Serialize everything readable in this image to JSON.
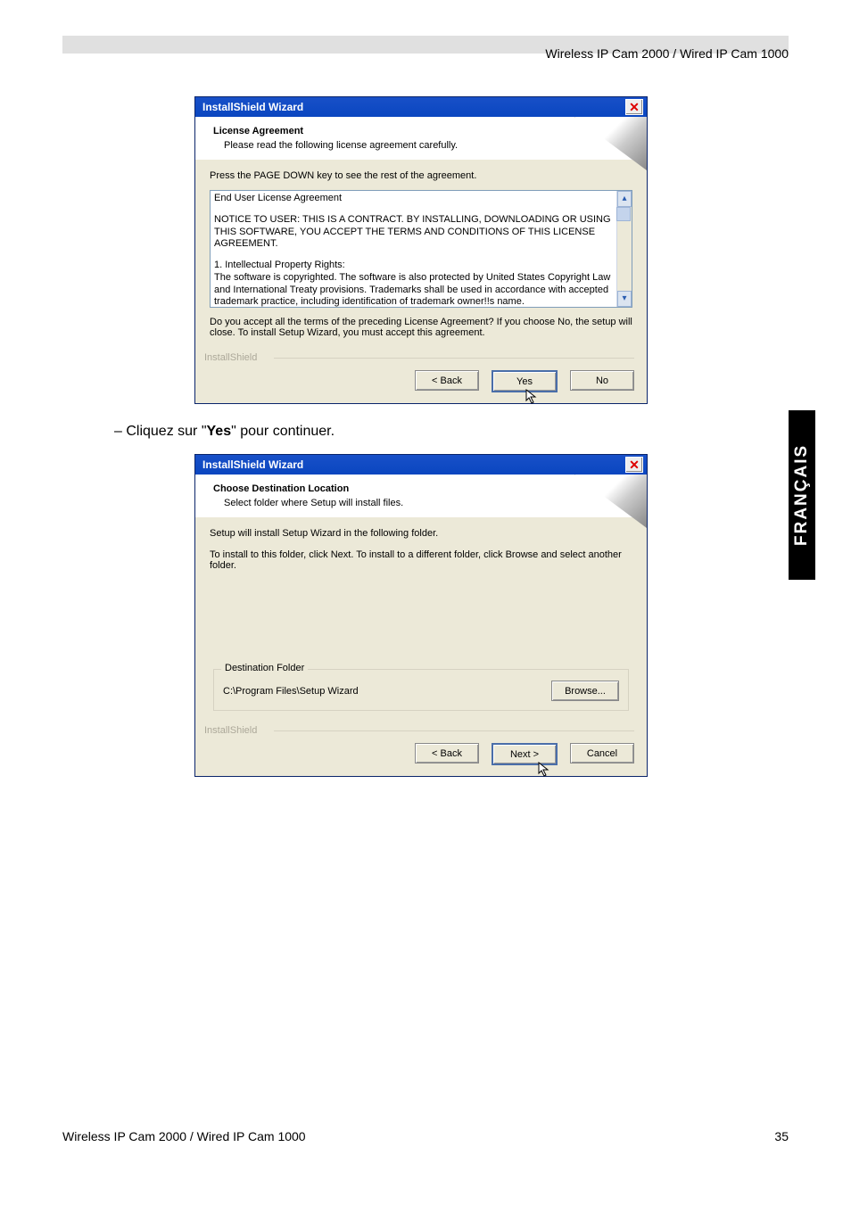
{
  "header": {
    "title": "Wireless IP Cam 2000 / Wired IP Cam 1000"
  },
  "footer": {
    "left": "Wireless IP Cam 2000 / Wired IP Cam 1000",
    "page": "35"
  },
  "side_tab": "FRANÇAIS",
  "instruction": {
    "prefix": "–   Cliquez sur \"",
    "bold": "Yes",
    "suffix": "\" pour continuer."
  },
  "dialog1": {
    "title": "InstallShield Wizard",
    "heading": "License Agreement",
    "sub": "Please read the following license agreement carefully.",
    "press_hint": "Press the PAGE DOWN key to see the rest of the agreement.",
    "eula_l1": "End User License Agreement",
    "eula_l2": "NOTICE TO USER:  THIS IS A CONTRACT.  BY INSTALLING, DOWNLOADING OR USING THIS SOFTWARE, YOU ACCEPT THE TERMS AND CONDITIONS OF THIS LICENSE AGREEMENT.",
    "eula_l3": "1.  Intellectual Property Rights:",
    "eula_l4": "The software is copyrighted.  The software is also protected by United States Copyright Law and International Treaty provisions.  Trademarks shall be used in accordance with accepted trademark practice, including identification of trademark owner!!s name.",
    "accept_q": "Do you accept all the terms of the preceding License Agreement?  If you choose No,  the setup will close.  To install Setup Wizard, you must accept this agreement.",
    "brand": "InstallShield",
    "btn_back": "< Back",
    "btn_yes": "Yes",
    "btn_no": "No"
  },
  "dialog2": {
    "title": "InstallShield Wizard",
    "heading": "Choose Destination Location",
    "sub": "Select folder where Setup will install files.",
    "line1": "Setup will install Setup Wizard in the following folder.",
    "line2": "To install to this folder, click Next. To install to a different folder, click Browse and select another folder.",
    "dest_legend": "Destination Folder",
    "dest_path": "C:\\Program Files\\Setup Wizard",
    "browse": "Browse...",
    "brand": "InstallShield",
    "btn_back": "< Back",
    "btn_next": "Next >",
    "btn_cancel": "Cancel"
  }
}
